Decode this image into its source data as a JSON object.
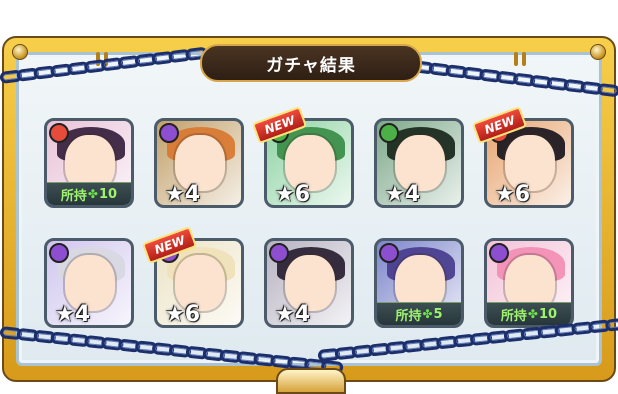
{
  "title": "ガチャ結果",
  "owned_label": "所持",
  "characters": [
    {
      "element": "fire",
      "element_color": "#e64b3b",
      "new": false,
      "stars": "",
      "owned": "10",
      "bg": "#e9c2d8",
      "hair": "#3a2440"
    },
    {
      "element": "dark",
      "element_color": "#8d4fd0",
      "new": false,
      "stars": "★4",
      "owned": "",
      "bg": "#c2a06a",
      "hair": "#d87a34"
    },
    {
      "element": "wood",
      "element_color": "#4db046",
      "new": true,
      "stars": "★6",
      "owned": "",
      "bg": "#8ed3a3",
      "hair": "#3c8f4a"
    },
    {
      "element": "wood",
      "element_color": "#4db046",
      "new": false,
      "stars": "★4",
      "owned": "",
      "bg": "#7ea88a",
      "hair": "#1c2b20"
    },
    {
      "element": "fire",
      "element_color": "#e64b3b",
      "new": true,
      "stars": "★6",
      "owned": "",
      "bg": "#e7a46f",
      "hair": "#1f1a22"
    },
    {
      "element": "dark",
      "element_color": "#8d4fd0",
      "new": false,
      "stars": "★4",
      "owned": "",
      "bg": "#d0c6ee",
      "hair": "#d8d8e2"
    },
    {
      "element": "dark",
      "element_color": "#8d4fd0",
      "new": true,
      "stars": "★6",
      "owned": "",
      "bg": "#ece3c6",
      "hair": "#efe2b8"
    },
    {
      "element": "dark",
      "element_color": "#8d4fd0",
      "new": false,
      "stars": "★4",
      "owned": "",
      "bg": "#b7b3c2",
      "hair": "#2c2436"
    },
    {
      "element": "dark",
      "element_color": "#8d4fd0",
      "new": false,
      "stars": "",
      "owned": "5",
      "bg": "#7d86cb",
      "hair": "#4b3f8f"
    },
    {
      "element": "dark",
      "element_color": "#8d4fd0",
      "new": false,
      "stars": "",
      "owned": "10",
      "bg": "#f3c3d7",
      "hair": "#f28fb5"
    }
  ],
  "new_label": "NEW",
  "element_icons": {
    "fire": "flame-icon",
    "wood": "leaf-icon",
    "dark": "moon-icon"
  }
}
